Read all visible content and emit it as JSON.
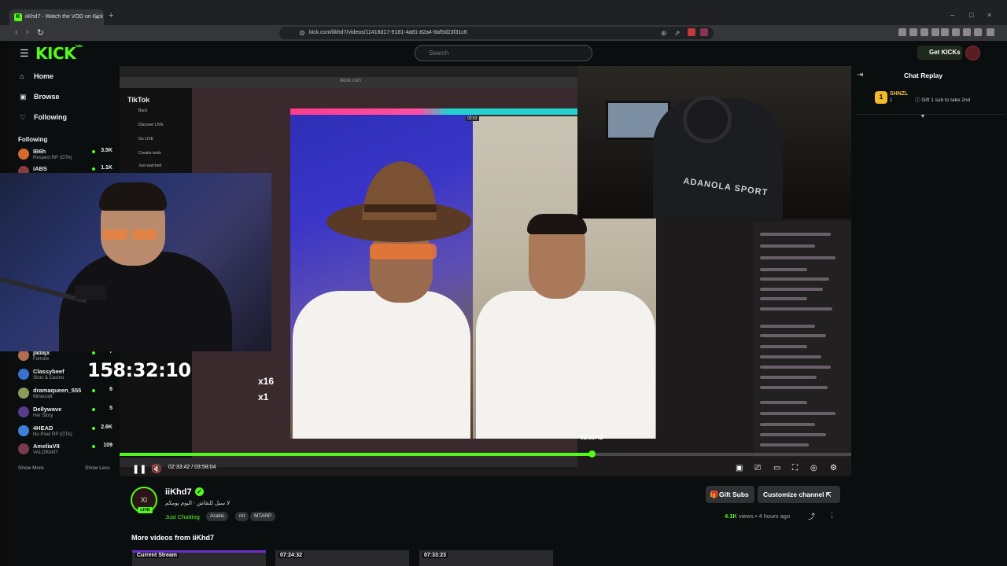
{
  "browser": {
    "tab_title": "iiKhd7 - Watch the VOD on Kick",
    "tab_favicon": "K",
    "tab_close": "×",
    "new_tab": "+",
    "window_controls": [
      "–",
      "□",
      "×"
    ],
    "url": "kick.com/iikhd7/videos/11418d17-9181-4a81-82a4-8af5d23f31c6",
    "nav": {
      "back": "‹",
      "forward": "›",
      "reload": "↻"
    }
  },
  "header": {
    "logo": "KICK",
    "logo_sup": "beta",
    "search_placeholder": "Search",
    "get_kicks_label": "Get KICKs"
  },
  "sidebar": {
    "nav": [
      {
        "label": "Home",
        "icon": "home-icon",
        "glyph": "⌂"
      },
      {
        "label": "Browse",
        "icon": "browse-icon",
        "glyph": "▣"
      },
      {
        "label": "Following",
        "icon": "heart-icon",
        "glyph": "♡"
      }
    ],
    "following_title": "Following",
    "channels_top": [
      {
        "name": "IB6h",
        "game": "Respect RP (GTA)",
        "viewers": "3.5K",
        "color": "#d46a2c"
      },
      {
        "name": "iABS",
        "game": "",
        "viewers": "1.1K",
        "color": "#8a3c3c"
      }
    ],
    "channels_bottom": [
      {
        "name": "jadajx",
        "game": "Fortnite",
        "viewers": "7",
        "color": "#b06f53"
      },
      {
        "name": "Classybeef",
        "game": "Slots & Casino",
        "viewers": "6",
        "color": "#3a6fd4"
      },
      {
        "name": "dramaqueen_555",
        "game": "Minecraft",
        "viewers": "6",
        "color": "#8a9b5a"
      },
      {
        "name": "Dellywave",
        "game": "Her Story",
        "viewers": "5",
        "color": "#5a3a8a"
      },
      {
        "name": "4HEAD",
        "game": "No Pixel RP (GTA)",
        "viewers": "2.6K",
        "color": "#3f7fd8"
      },
      {
        "name": "AmeliaVII",
        "game": "VALORANT",
        "viewers": "109",
        "color": "#7a3a4a"
      }
    ],
    "show_more": "Show More",
    "show_less": "Show Less"
  },
  "player": {
    "overlay_timer": "158:32:10",
    "hover_time": "02:33:42",
    "current_time": "02:33:42",
    "duration": "03:58:04",
    "timecode_display": "02:33:42 / 03:58:04",
    "progress": 0.6451,
    "inner_url": "tiktok.com",
    "tiktok_brand": "TikTok",
    "tiktok_menu": [
      "Back",
      "Discover LIVE",
      "Go LIVE",
      "Creator tools",
      "Just watched"
    ],
    "pk_timer": "03:03",
    "gift_counts": [
      "x16",
      "x1"
    ],
    "hoodie_text": "ADANOLA SPORT"
  },
  "channel": {
    "name": "iiKhd7",
    "avatar_text": "XI",
    "live_badge": "LIVE",
    "title": "لا سيل للنقاش - اليوم يومكم",
    "category": "Just Chatting",
    "tags": [
      "Arabic",
      "mt",
      "MTARP"
    ],
    "gift_subs_label": "Gift Subs",
    "customize_label": "Customize channel",
    "views_count": "4.1K",
    "views_label": "views",
    "time_ago": "4 hours ago"
  },
  "more_videos": {
    "title": "More videos from iiKhd7",
    "thumbs": [
      {
        "label": "Current Stream"
      },
      {
        "label": "07:24:32"
      },
      {
        "label": "07:33:23"
      }
    ]
  },
  "chat": {
    "title": "Chat Replay",
    "sub_user": "SHNZL",
    "sub_count": "1",
    "sub_text": "Gift 1 sub to take 2nd"
  },
  "colors": {
    "brand": "#53fc18",
    "bg": "#0b0e0f",
    "button_bg": "#2f3133"
  }
}
